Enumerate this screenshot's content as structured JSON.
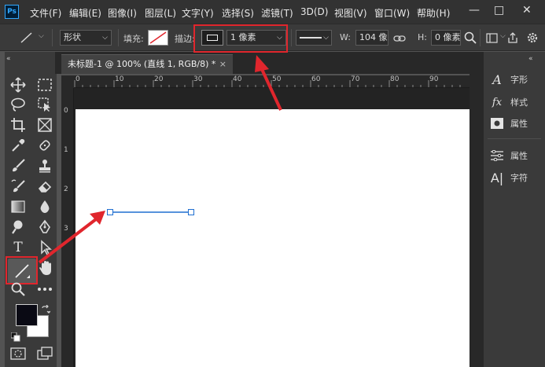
{
  "menu": {
    "logo": "Ps",
    "items": [
      "文件(F)",
      "编辑(E)",
      "图像(I)",
      "图层(L)",
      "文字(Y)",
      "选择(S)",
      "滤镜(T)",
      "3D(D)",
      "视图(V)",
      "窗口(W)",
      "帮助(H)"
    ],
    "minimize": "—",
    "restore": "□",
    "close": "✕"
  },
  "options": {
    "mode_value": "形状",
    "fill_label": "填充:",
    "stroke_label": "描边:",
    "stroke_width": "1 像素",
    "w_label": "W:",
    "w_value": "104 像",
    "h_label": "H:",
    "h_value": "0 像素"
  },
  "document": {
    "tab_title": "未标题-1 @ 100% (直线 1, RGB/8) *",
    "tab_close": "×",
    "ruler_marks": [
      "0",
      "10",
      "20",
      "30",
      "40",
      "50",
      "60",
      "70",
      "80",
      "90"
    ],
    "vruler_marks": [
      "0",
      "1",
      "2",
      "3"
    ]
  },
  "toolbar": {
    "collapse": "«",
    "type_tool": "T"
  },
  "right_panel": {
    "collapse": "«",
    "items": [
      {
        "label": "字形",
        "icon": "A"
      },
      {
        "label": "样式",
        "icon": "fx"
      },
      {
        "label": "属性",
        "icon": "properties-icon"
      },
      {
        "label": "属性",
        "icon": "adjust-sliders-icon"
      },
      {
        "label": "字符",
        "icon": "A|"
      }
    ]
  },
  "colors": {
    "annotation_red": "#e0262d",
    "line_blue": "#1f6fd1",
    "foreground": "#0a0a14",
    "background": "#ffffff"
  }
}
